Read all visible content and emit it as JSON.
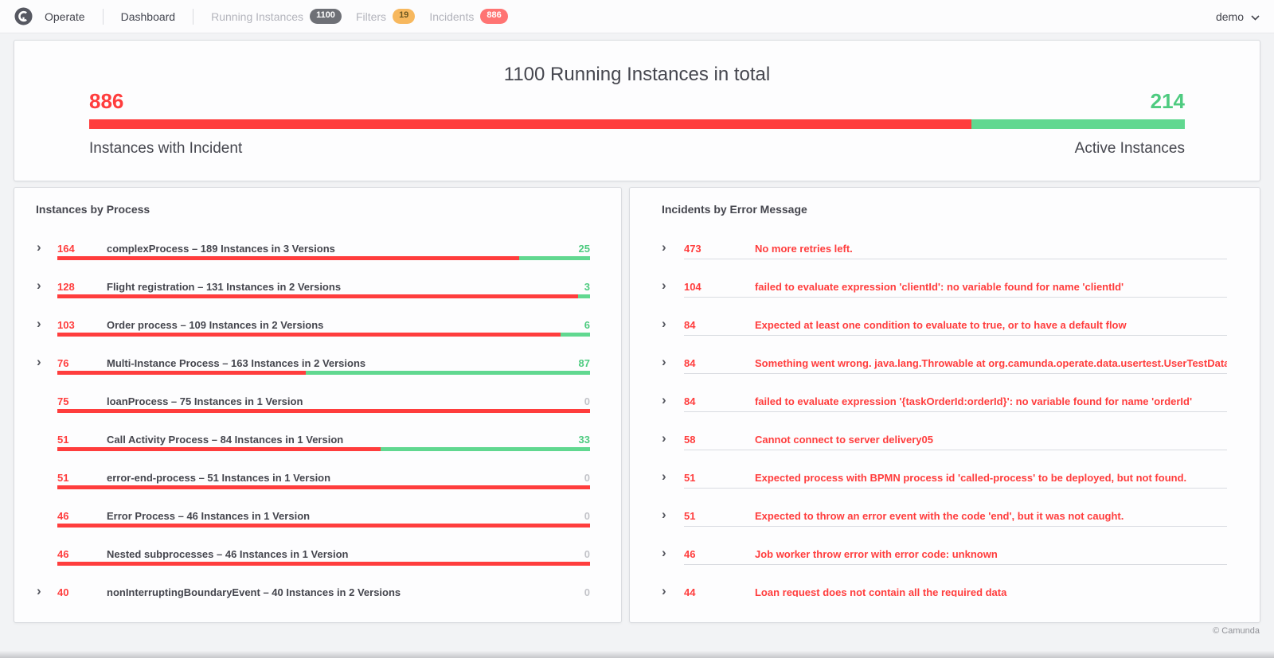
{
  "nav": {
    "brand": "Operate",
    "items": [
      {
        "label": "Dashboard",
        "active": true
      },
      {
        "label": "Running Instances",
        "badge": "1100"
      },
      {
        "label": "Filters",
        "badge": "19"
      },
      {
        "label": "Incidents",
        "badge": "886"
      }
    ],
    "user": {
      "name": "demo"
    }
  },
  "hero": {
    "title": "1100 Running Instances in total",
    "incidents": {
      "count": 886,
      "label": "Instances with Incident"
    },
    "active": {
      "count": 214,
      "label": "Active Instances"
    }
  },
  "instances_by_process": {
    "title": "Instances by Process",
    "rows": [
      {
        "expandable": true,
        "incidents": 164,
        "label": "complexProcess – 189 Instances in 3 Versions",
        "active": 25
      },
      {
        "expandable": true,
        "incidents": 128,
        "label": "Flight registration – 131 Instances in 2 Versions",
        "active": 3
      },
      {
        "expandable": true,
        "incidents": 103,
        "label": "Order process – 109 Instances in 2 Versions",
        "active": 6
      },
      {
        "expandable": true,
        "incidents": 76,
        "label": "Multi-Instance Process – 163 Instances in 2 Versions",
        "active": 87
      },
      {
        "expandable": false,
        "incidents": 75,
        "label": "loanProcess – 75 Instances in 1 Version",
        "active": 0
      },
      {
        "expandable": false,
        "incidents": 51,
        "label": "Call Activity Process – 84 Instances in 1 Version",
        "active": 33
      },
      {
        "expandable": false,
        "incidents": 51,
        "label": "error-end-process – 51 Instances in 1 Version",
        "active": 0
      },
      {
        "expandable": false,
        "incidents": 46,
        "label": "Error Process – 46 Instances in 1 Version",
        "active": 0
      },
      {
        "expandable": false,
        "incidents": 46,
        "label": "Nested subprocesses – 46 Instances in 1 Version",
        "active": 0
      },
      {
        "expandable": true,
        "incidents": 40,
        "label": "nonInterruptingBoundaryEvent – 40 Instances in 2 Versions",
        "active": 0
      }
    ]
  },
  "incidents_by_error": {
    "title": "Incidents by Error Message",
    "rows": [
      {
        "count": 473,
        "message": "No more retries left."
      },
      {
        "count": 104,
        "message": "failed to evaluate expression 'clientId': no variable found for name 'clientId'"
      },
      {
        "count": 84,
        "message": "Expected at least one condition to evaluate to true, or to have a default flow"
      },
      {
        "count": 84,
        "message": "Something went wrong. java.lang.Throwable at org.camunda.operate.data.usertest.UserTestDataGen…"
      },
      {
        "count": 84,
        "message": "failed to evaluate expression '{taskOrderId:orderId}': no variable found for name 'orderId'"
      },
      {
        "count": 58,
        "message": "Cannot connect to server delivery05"
      },
      {
        "count": 51,
        "message": "Expected process with BPMN process id 'called-process' to be deployed, but not found."
      },
      {
        "count": 51,
        "message": "Expected to throw an error event with the code 'end', but it was not caught."
      },
      {
        "count": 46,
        "message": "Job worker throw error with error code: unknown"
      },
      {
        "count": 44,
        "message": "Loan request does not contain all the required data"
      }
    ]
  },
  "footer": {
    "copyright": "© Camunda"
  },
  "colors": {
    "red": "#ff3d3d",
    "green-bar": "#61d890",
    "green-text": "#4ecb80",
    "badge-neutral": "#6e7076",
    "badge-warning": "#f7b85e",
    "badge-danger": "#ff7473",
    "text-dark": "#45464e",
    "text-muted": "#b3b4bc",
    "zero-gray": "#c3c4c9"
  }
}
